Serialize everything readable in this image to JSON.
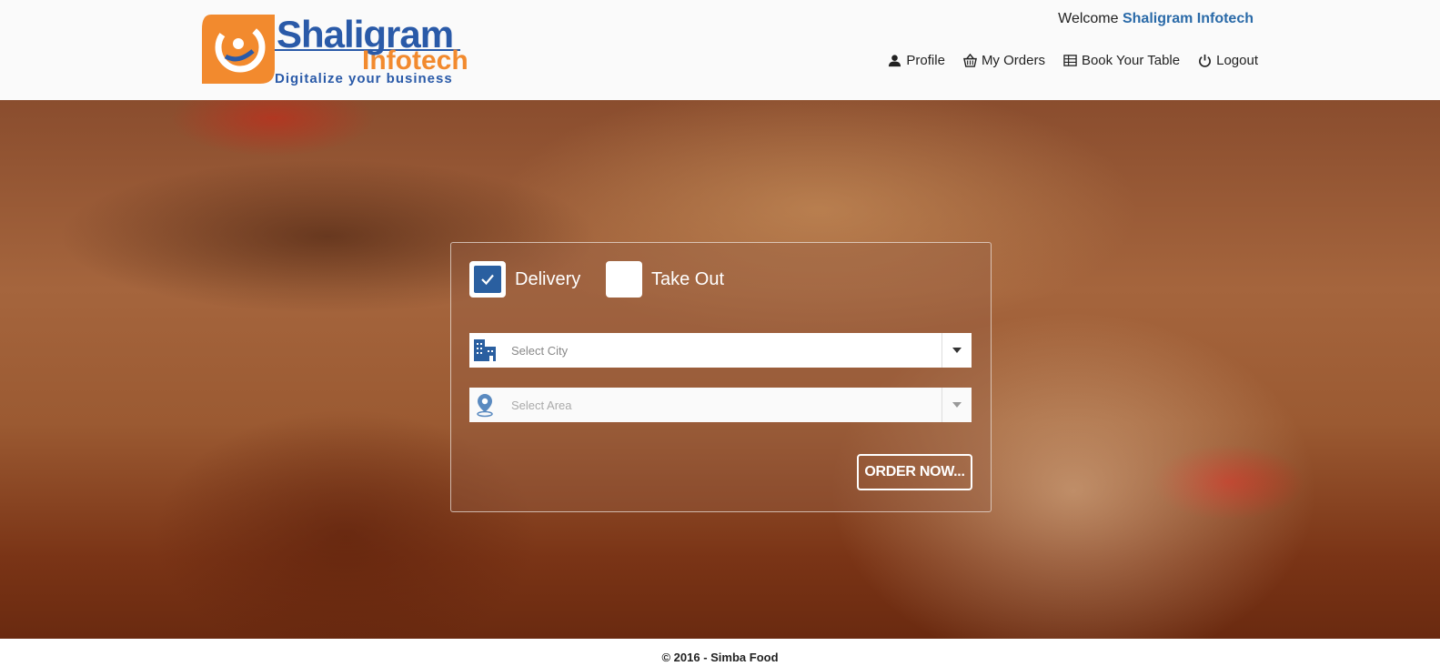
{
  "header": {
    "logo": {
      "name_part1": "Shaligram",
      "name_part2": "Infotech",
      "tagline": "Digitalize your business"
    },
    "welcome_prefix": "Welcome",
    "user_name": "Shaligram Infotech",
    "nav": [
      {
        "label": "Profile",
        "icon": "user-icon"
      },
      {
        "label": "My Orders",
        "icon": "basket-icon"
      },
      {
        "label": "Book Your Table",
        "icon": "table-icon"
      },
      {
        "label": "Logout",
        "icon": "power-icon"
      }
    ]
  },
  "order_form": {
    "options": [
      {
        "label": "Delivery",
        "checked": true
      },
      {
        "label": "Take Out",
        "checked": false
      }
    ],
    "city_select": {
      "placeholder": "Select  City",
      "icon": "building-icon"
    },
    "area_select": {
      "placeholder": "Select  Area",
      "icon": "location-pin-icon",
      "disabled": true
    },
    "submit_label": "ORDER NOW..."
  },
  "footer": {
    "copyright": "© 2016 - Simba Food"
  },
  "colors": {
    "brand_blue": "#2a5aa8",
    "brand_orange": "#f28a2e",
    "checkbox_blue": "#2a5fa0"
  }
}
